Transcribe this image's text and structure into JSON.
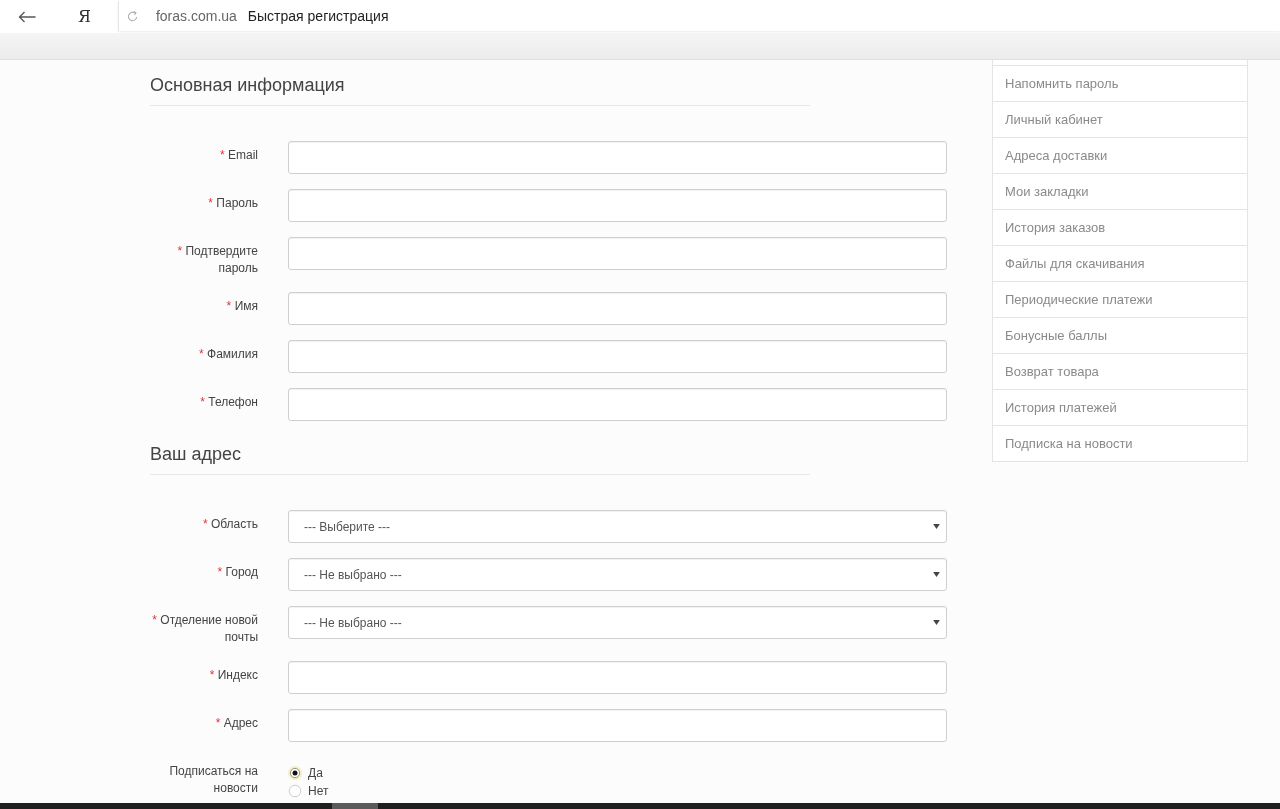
{
  "browser": {
    "logo": "Я",
    "domain": "foras.com.ua",
    "page_title": "Быстрая регистрация"
  },
  "sections": [
    {
      "title": "Основная информация",
      "fields": [
        {
          "kind": "text",
          "required_mark": "*",
          "label": "Email"
        },
        {
          "kind": "text",
          "required_mark": "*",
          "label": "Пароль"
        },
        {
          "kind": "text",
          "required_mark": "*",
          "label": "Подтвердите пароль"
        },
        {
          "kind": "text",
          "required_mark": "*",
          "label": "Имя"
        },
        {
          "kind": "text",
          "required_mark": "*",
          "label": "Фамилия"
        },
        {
          "kind": "text",
          "required_mark": "*",
          "label": "Телефон"
        }
      ]
    },
    {
      "title": "Ваш адрес",
      "fields": [
        {
          "kind": "select",
          "required_mark": "*",
          "label": "Область",
          "value": "--- Выберите ---"
        },
        {
          "kind": "select",
          "required_mark": "*",
          "label": "Город",
          "value": "--- Не выбрано ---"
        },
        {
          "kind": "select",
          "required_mark": "*",
          "label": "Отделение новой почты",
          "value": "--- Не выбрано ---"
        },
        {
          "kind": "text",
          "required_mark": "*",
          "label": "Индекс"
        },
        {
          "kind": "text",
          "required_mark": "*",
          "label": "Адрес"
        },
        {
          "kind": "radio",
          "label": "Подписаться на новости",
          "options": [
            {
              "label": "Да",
              "selected": true
            },
            {
              "label": "Нет",
              "selected": false
            }
          ]
        }
      ]
    }
  ],
  "sidebar": {
    "items": [
      "Напомнить пароль",
      "Личный кабинет",
      "Адреса доставки",
      "Мои закладки",
      "История заказов",
      "Файлы для скачивания",
      "Периодические платежи",
      "Бонусные баллы",
      "Возврат товара",
      "История платежей",
      "Подписка на новости"
    ]
  }
}
